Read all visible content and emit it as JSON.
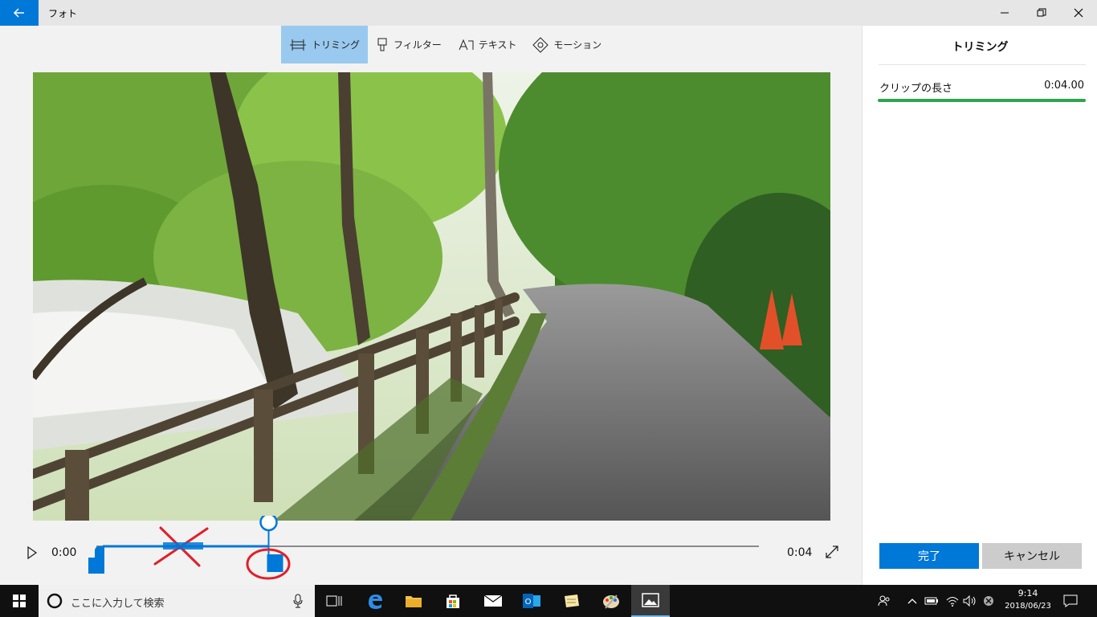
{
  "window": {
    "title": "フォト"
  },
  "toolbar": {
    "items": [
      {
        "label": "トリミング",
        "icon": "trim-icon",
        "active": true
      },
      {
        "label": "フィルター",
        "icon": "filter-icon",
        "active": false
      },
      {
        "label": "テキスト",
        "icon": "text-icon",
        "active": false
      },
      {
        "label": "モーション",
        "icon": "motion-icon",
        "active": false
      }
    ]
  },
  "player": {
    "time_start": "0:00",
    "time_end": "0:04",
    "playhead_fraction": 0.26,
    "trim_start_fraction": 0.0,
    "trim_end_fraction": 0.26
  },
  "panel": {
    "title": "トリミング",
    "clip_length_label": "クリップの長さ",
    "clip_length_value": "0:04.00",
    "done_label": "完了",
    "cancel_label": "キャンセル",
    "accent_color": "#2ea44f"
  },
  "taskbar": {
    "search_placeholder": "ここに入力して検索",
    "time": "9:14",
    "date": "2018/06/23"
  },
  "colors": {
    "accent": "#0078d7",
    "annotation_red": "#e0202a"
  }
}
